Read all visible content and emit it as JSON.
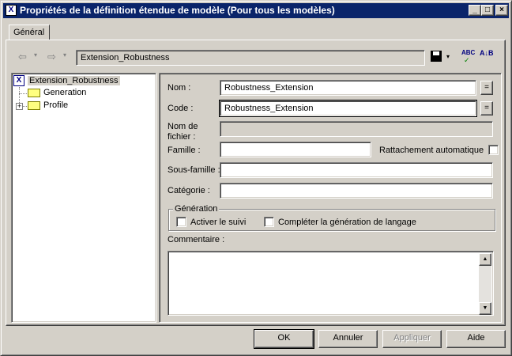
{
  "window": {
    "title": "Propriétés de la définition étendue de modèle (Pour tous les modèles)",
    "controls": {
      "minimize": "_",
      "maximize": "□",
      "close": "×"
    }
  },
  "tabs": [
    {
      "label": "Général",
      "active": true
    }
  ],
  "toolbar": {
    "path_value": "Extension_Robustness",
    "icons": [
      "back-arrow-icon",
      "forward-arrow-icon",
      "save-icon",
      "spell-check-icon",
      "sort-icon"
    ],
    "spell_label": "ABC",
    "sort_label": "A↓B"
  },
  "tree": {
    "root": {
      "label": "Extension_Robustness",
      "icon": "extension-icon"
    },
    "children": [
      {
        "label": "Generation",
        "icon": "folder-icon",
        "expandable": false
      },
      {
        "label": "Profile",
        "icon": "folder-icon",
        "expandable": true
      }
    ]
  },
  "form": {
    "nom": {
      "label": "Nom :",
      "value": "Robustness_Extension"
    },
    "code": {
      "label": "Code :",
      "value": "Robustness_Extension"
    },
    "nom_fichier": {
      "label_line1": "Nom de",
      "label_line2": "fichier :",
      "value": ""
    },
    "famille": {
      "label": "Famille :",
      "value": ""
    },
    "rattachement": {
      "label": "Rattachement automatique",
      "checked": false
    },
    "sous_famille": {
      "label": "Sous-famille :",
      "value": ""
    },
    "categorie": {
      "label": "Catégorie :",
      "value": ""
    },
    "generation_group": {
      "label": "Génération",
      "activer_suivi": {
        "label": "Activer le suivi",
        "checked": false
      },
      "completer": {
        "label": "Compléter la génération de langage",
        "checked": false
      }
    },
    "commentaire": {
      "label": "Commentaire :",
      "value": ""
    },
    "eq_button": "="
  },
  "buttons": {
    "ok": "OK",
    "annuler": "Annuler",
    "appliquer": "Appliquer",
    "aide": "Aide"
  },
  "colors": {
    "titlebar": "#0a246a",
    "face": "#d4d0c8",
    "selection": "#d4d0c8"
  }
}
